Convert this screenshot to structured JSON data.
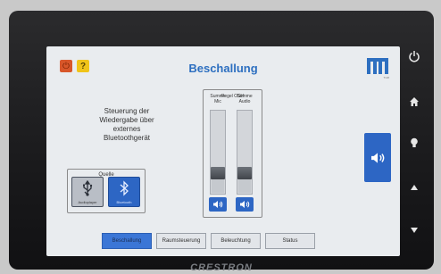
{
  "header": {
    "title": "Beschallung",
    "logo_text": "TUM"
  },
  "description": [
    "Steuerung der",
    "Wiedergabe über",
    "externes",
    "Bluetoothgerät"
  ],
  "source": {
    "legend": "Quelle",
    "options": [
      {
        "label": "Audioplayer",
        "icon": "usb-icon",
        "selected": false
      },
      {
        "label": "Bluetooth",
        "icon": "bluetooth-icon",
        "selected": true
      }
    ]
  },
  "level": {
    "legend": "Pegel OSH",
    "channels": [
      {
        "line1": "Summe",
        "line2": "Mic",
        "level": 0.2,
        "muted": false
      },
      {
        "line1": "Summe",
        "line2": "Audio",
        "level": 0.2,
        "muted": false
      }
    ]
  },
  "tabs": [
    {
      "label": "Beschallung",
      "active": true
    },
    {
      "label": "Raumsteuerung",
      "active": false
    },
    {
      "label": "Beleuchtung",
      "active": false
    },
    {
      "label": "Status",
      "active": false
    }
  ],
  "brand": "CRESTRON",
  "colors": {
    "accent": "#2d66c4",
    "title": "#2d6fc0",
    "power": "#d8572a",
    "help": "#f0c419"
  },
  "hardware_buttons": [
    "power-icon",
    "home-icon",
    "bulb-icon",
    "up-arrow-icon",
    "down-arrow-icon"
  ]
}
